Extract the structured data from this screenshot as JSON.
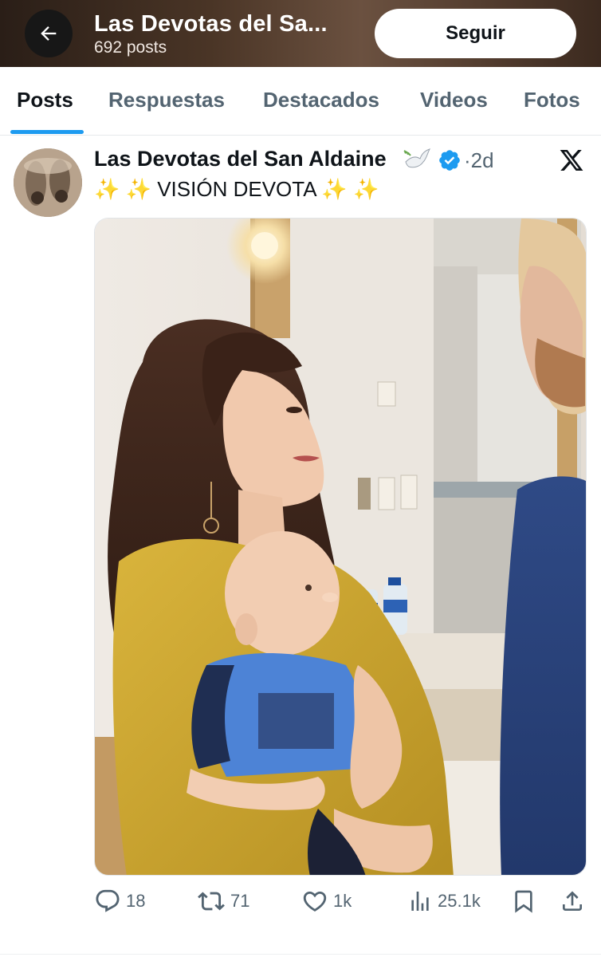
{
  "header": {
    "title": "Las Devotas del Sa...",
    "subtitle": "692 posts",
    "follow_label": "Seguir",
    "back_icon": "arrow-left-icon"
  },
  "tabs": [
    {
      "label": "Posts",
      "active": true
    },
    {
      "label": "Respuestas",
      "active": false
    },
    {
      "label": "Destacados",
      "active": false
    },
    {
      "label": "Videos",
      "active": false
    },
    {
      "label": "Fotos",
      "active": false
    }
  ],
  "post": {
    "author": "Las Devotas del San Aldaine",
    "author_emoji": "dove-icon",
    "verified": true,
    "time": "·2d",
    "text_prefix": "✨ ✨",
    "text_main": "VISIÓN DEVOTA",
    "text_suffix": "✨ ✨",
    "media_description_icon": "photo",
    "actions": {
      "replies": "18",
      "reposts": "71",
      "likes": "1k",
      "views": "25.1k"
    }
  },
  "colors": {
    "accent": "#1d9bf0",
    "text": "#0f1419",
    "muted": "#536471",
    "verified": "#1d9bf0"
  }
}
